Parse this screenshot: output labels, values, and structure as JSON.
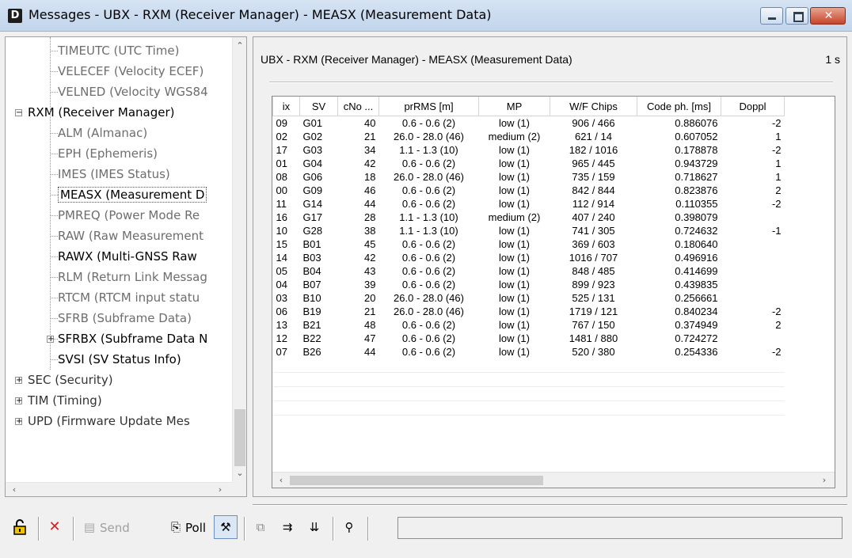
{
  "window": {
    "title": "Messages - UBX - RXM (Receiver Manager) - MEASX (Measurement Data)",
    "app_icon": "D",
    "close_glyph": "✕"
  },
  "tree": {
    "rows": [
      {
        "label": "TIMEUTC (UTC Time)",
        "level": "child",
        "strong": false
      },
      {
        "label": "VELECEF (Velocity ECEF)",
        "level": "child",
        "strong": false
      },
      {
        "label": "VELNED (Velocity WGS84",
        "level": "child",
        "strong": false
      },
      {
        "label": "RXM (Receiver Manager)",
        "level": "top",
        "toggle": "−"
      },
      {
        "label": "ALM (Almanac)",
        "level": "child",
        "strong": false
      },
      {
        "label": "EPH (Ephemeris)",
        "level": "child",
        "strong": false
      },
      {
        "label": "IMES (IMES Status)",
        "level": "child",
        "strong": false
      },
      {
        "label": "MEASX (Measurement D",
        "level": "child",
        "strong": true,
        "selected": true
      },
      {
        "label": "PMREQ (Power Mode Re",
        "level": "child",
        "strong": false
      },
      {
        "label": "RAW (Raw Measurement",
        "level": "child",
        "strong": false
      },
      {
        "label": "RAWX (Multi-GNSS Raw",
        "level": "child",
        "strong": true
      },
      {
        "label": "RLM (Return Link Messag",
        "level": "child",
        "strong": false
      },
      {
        "label": "RTCM (RTCM input statu",
        "level": "child",
        "strong": false
      },
      {
        "label": "SFRB (Subframe Data)",
        "level": "child",
        "strong": false
      },
      {
        "label": "SFRBX (Subframe Data N",
        "level": "child",
        "strong": true,
        "toggle": "+"
      },
      {
        "label": "SVSI (SV Status Info)",
        "level": "child",
        "strong": true
      },
      {
        "label": "SEC (Security)",
        "level": "top",
        "muted": true,
        "toggle": "+"
      },
      {
        "label": "TIM (Timing)",
        "level": "top",
        "muted": true,
        "toggle": "+"
      },
      {
        "label": "UPD (Firmware Update Mes",
        "level": "top",
        "muted": true,
        "toggle": "+"
      }
    ]
  },
  "panel": {
    "header": "UBX - RXM (Receiver Manager) - MEASX (Measurement Data)",
    "rate": "1 s"
  },
  "table": {
    "columns": [
      "ix",
      "SV",
      "cNo ...",
      "prRMS [m]",
      "MP",
      "W/F Chips",
      "Code ph. [ms]",
      "Doppl"
    ],
    "rows": [
      [
        "09",
        "G01",
        "40",
        "0.6 - 0.6 (2)",
        "low (1)",
        "906 / 466",
        "0.886076",
        "-2"
      ],
      [
        "02",
        "G02",
        "21",
        "26.0 - 28.0 (46)",
        "medium (2)",
        "621 / 14",
        "0.607052",
        "1"
      ],
      [
        "17",
        "G03",
        "34",
        "1.1 - 1.3 (10)",
        "low (1)",
        "182 / 1016",
        "0.178878",
        "-2"
      ],
      [
        "01",
        "G04",
        "42",
        "0.6 - 0.6 (2)",
        "low (1)",
        "965 / 445",
        "0.943729",
        "1"
      ],
      [
        "08",
        "G06",
        "18",
        "26.0 - 28.0 (46)",
        "low (1)",
        "735 / 159",
        "0.718627",
        "1"
      ],
      [
        "00",
        "G09",
        "46",
        "0.6 - 0.6 (2)",
        "low (1)",
        "842 / 844",
        "0.823876",
        "2"
      ],
      [
        "11",
        "G14",
        "44",
        "0.6 - 0.6 (2)",
        "low (1)",
        "112 / 914",
        "0.110355",
        "-2"
      ],
      [
        "16",
        "G17",
        "28",
        "1.1 - 1.3 (10)",
        "medium (2)",
        "407 / 240",
        "0.398079",
        ""
      ],
      [
        "10",
        "G28",
        "38",
        "1.1 - 1.3 (10)",
        "low (1)",
        "741 / 305",
        "0.724632",
        "-1"
      ],
      [
        "15",
        "B01",
        "45",
        "0.6 - 0.6 (2)",
        "low (1)",
        "369 / 603",
        "0.180640",
        ""
      ],
      [
        "14",
        "B03",
        "42",
        "0.6 - 0.6 (2)",
        "low (1)",
        "1016 / 707",
        "0.496916",
        ""
      ],
      [
        "05",
        "B04",
        "43",
        "0.6 - 0.6 (2)",
        "low (1)",
        "848 / 485",
        "0.414699",
        ""
      ],
      [
        "04",
        "B07",
        "39",
        "0.6 - 0.6 (2)",
        "low (1)",
        "899 / 923",
        "0.439835",
        ""
      ],
      [
        "03",
        "B10",
        "20",
        "26.0 - 28.0 (46)",
        "low (1)",
        "525 / 131",
        "0.256661",
        ""
      ],
      [
        "06",
        "B19",
        "21",
        "26.0 - 28.0 (46)",
        "low (1)",
        "1719 / 121",
        "0.840234",
        "-2"
      ],
      [
        "13",
        "B21",
        "48",
        "0.6 - 0.6 (2)",
        "low (1)",
        "767 / 150",
        "0.374949",
        "2"
      ],
      [
        "12",
        "B22",
        "47",
        "0.6 - 0.6 (2)",
        "low (1)",
        "1481 / 880",
        "0.724272",
        ""
      ],
      [
        "07",
        "B26",
        "44",
        "0.6 - 0.6 (2)",
        "low (1)",
        "520 / 380",
        "0.254336",
        "-2"
      ]
    ],
    "empty_rows": 4
  },
  "toolbar": {
    "send_label": "Send",
    "poll_label": "Poll",
    "icons": [
      "lock-icon",
      "delete-icon",
      "send-icon",
      "poll-icon",
      "auto-poll-icon",
      "copy-icon",
      "import-icon",
      "export-icon",
      "binoculars-icon"
    ]
  },
  "colors": {
    "title_gradient_top": "#d5e3f3",
    "close_button": "#c6452b",
    "delete_red": "#d42020",
    "lock_yellow": "#f2c200"
  }
}
